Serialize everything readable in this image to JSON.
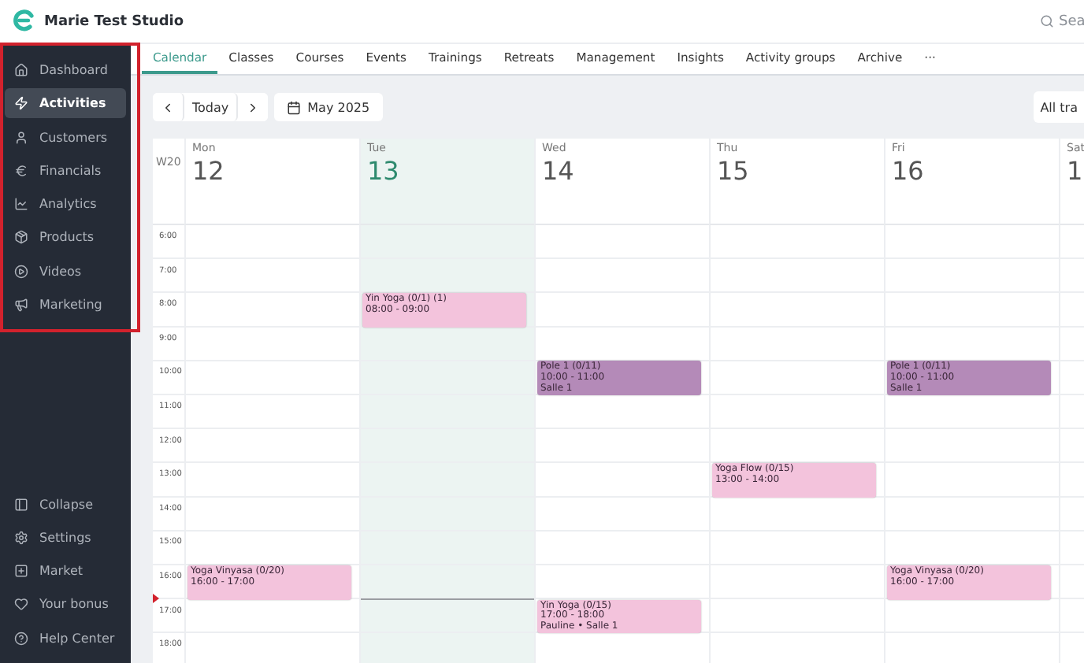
{
  "header": {
    "studio_name": "Marie Test Studio",
    "search": {
      "placeholder": "Sea"
    }
  },
  "sidebar": {
    "items": [
      {
        "label": "Dashboard",
        "selected": false
      },
      {
        "label": "Activities",
        "selected": true
      },
      {
        "label": "Customers",
        "selected": false
      },
      {
        "label": "Financials",
        "selected": false
      },
      {
        "label": "Analytics",
        "selected": false
      },
      {
        "label": "Products",
        "selected": false
      },
      {
        "label": "Videos",
        "selected": false
      },
      {
        "label": "Marketing",
        "selected": false
      }
    ],
    "bottom_items": [
      "Collapse",
      "Settings",
      "Market",
      "Your bonus",
      "Help Center"
    ]
  },
  "tabs": [
    {
      "label": "Calendar",
      "selected": true
    },
    {
      "label": "Classes",
      "selected": false
    },
    {
      "label": "Courses",
      "selected": false
    },
    {
      "label": "Events",
      "selected": false
    },
    {
      "label": "Trainings",
      "selected": false
    },
    {
      "label": "Retreats",
      "selected": false
    },
    {
      "label": "Management",
      "selected": false
    },
    {
      "label": "Insights",
      "selected": false
    },
    {
      "label": "Activity groups",
      "selected": false
    },
    {
      "label": "Archive",
      "selected": false
    }
  ],
  "more_tab": "···",
  "toolbar": {
    "today": "Today",
    "month": "May 2025",
    "filter": "All tra"
  },
  "calendar": {
    "week": "W20",
    "hours": [
      "6:00",
      "7:00",
      "8:00",
      "9:00",
      "10:00",
      "11:00",
      "12:00",
      "13:00",
      "14:00",
      "15:00",
      "16:00",
      "17:00",
      "18:00"
    ],
    "days": [
      {
        "name": "Mon",
        "date": "12",
        "today": false,
        "events": [
          {
            "title": "Yoga Vinyasa (0/20)",
            "time": "16:00 - 17:00",
            "color": "#f3c3dc"
          }
        ]
      },
      {
        "name": "Tue",
        "date": "13",
        "today": true,
        "events": [
          {
            "title": "Yin Yoga (0/1) (1)",
            "time": "08:00 - 09:00",
            "color": "#f3c3dc"
          }
        ]
      },
      {
        "name": "Wed",
        "date": "14",
        "today": false,
        "events": [
          {
            "title": "Pole 1 (0/11)",
            "time": "10:00 - 11:00",
            "location": "Salle 1",
            "color": "#b48ab8"
          },
          {
            "title": "Yin Yoga (0/15)",
            "time": "17:00 - 18:00",
            "location": "Pauline • Salle 1",
            "color": "#f3c3dc"
          }
        ]
      },
      {
        "name": "Thu",
        "date": "15",
        "today": false,
        "events": [
          {
            "title": "Yoga Flow (0/15)",
            "time": "13:00 - 14:00",
            "color": "#f3c3dc"
          }
        ]
      },
      {
        "name": "Fri",
        "date": "16",
        "today": false,
        "events": [
          {
            "title": "Pole 1 (0/11)",
            "time": "10:00 - 11:00",
            "location": "Salle 1",
            "color": "#b48ab8"
          },
          {
            "title": "Yoga Vinyasa (0/20)",
            "time": "16:00 - 17:00",
            "color": "#f3c3dc"
          }
        ]
      },
      {
        "name": "Sat",
        "date": "1",
        "today": false
      }
    ]
  }
}
